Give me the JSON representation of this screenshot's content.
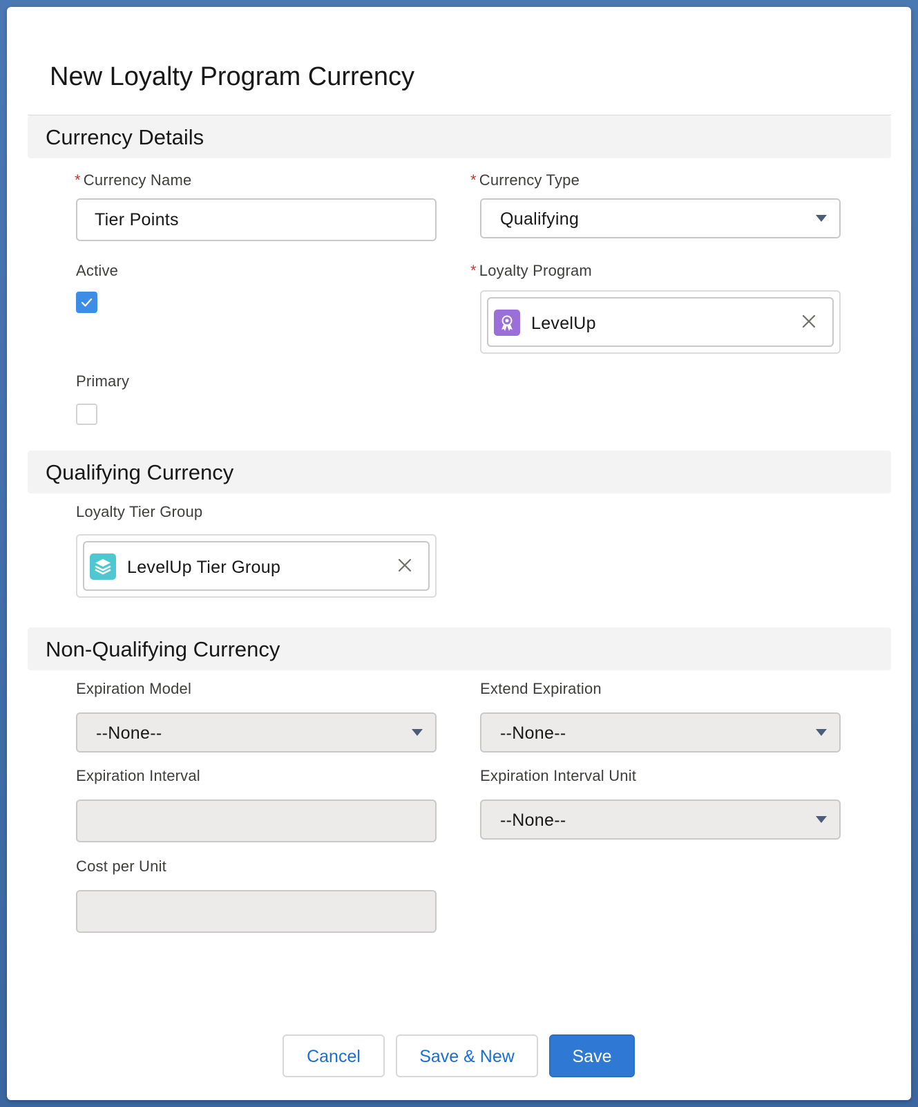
{
  "modal": {
    "title": "New Loyalty Program Currency"
  },
  "sections": {
    "details": "Currency Details",
    "qualifying": "Qualifying Currency",
    "non_qualifying": "Non-Qualifying Currency"
  },
  "fields": {
    "currency_name": {
      "label": "Currency Name",
      "required": "*",
      "value": "Tier Points"
    },
    "currency_type": {
      "label": "Currency Type",
      "required": "*",
      "value": "Qualifying"
    },
    "active": {
      "label": "Active",
      "checked": true
    },
    "loyalty_program": {
      "label": "Loyalty Program",
      "required": "*",
      "value": "LevelUp",
      "icon": "loyalty-program-icon"
    },
    "primary": {
      "label": "Primary",
      "checked": false
    },
    "loyalty_tier_group": {
      "label": "Loyalty Tier Group",
      "value": "LevelUp Tier Group",
      "icon": "tier-group-icon"
    },
    "expiration_model": {
      "label": "Expiration Model",
      "value": "--None--"
    },
    "extend_expiration": {
      "label": "Extend Expiration",
      "value": "--None--"
    },
    "expiration_interval": {
      "label": "Expiration Interval",
      "value": ""
    },
    "expiration_interval_unit": {
      "label": "Expiration Interval Unit",
      "value": "--None--"
    },
    "cost_per_unit": {
      "label": "Cost per Unit",
      "value": ""
    }
  },
  "buttons": {
    "cancel": "Cancel",
    "save_new": "Save & New",
    "save": "Save"
  },
  "colors": {
    "brand": "#2f79d4",
    "link": "#1b6ed3",
    "required": "#c23934",
    "checkbox": "#3d8de6",
    "loyalty_icon_bg": "#9b6fd8",
    "tier_icon_bg": "#4fc7d3"
  }
}
